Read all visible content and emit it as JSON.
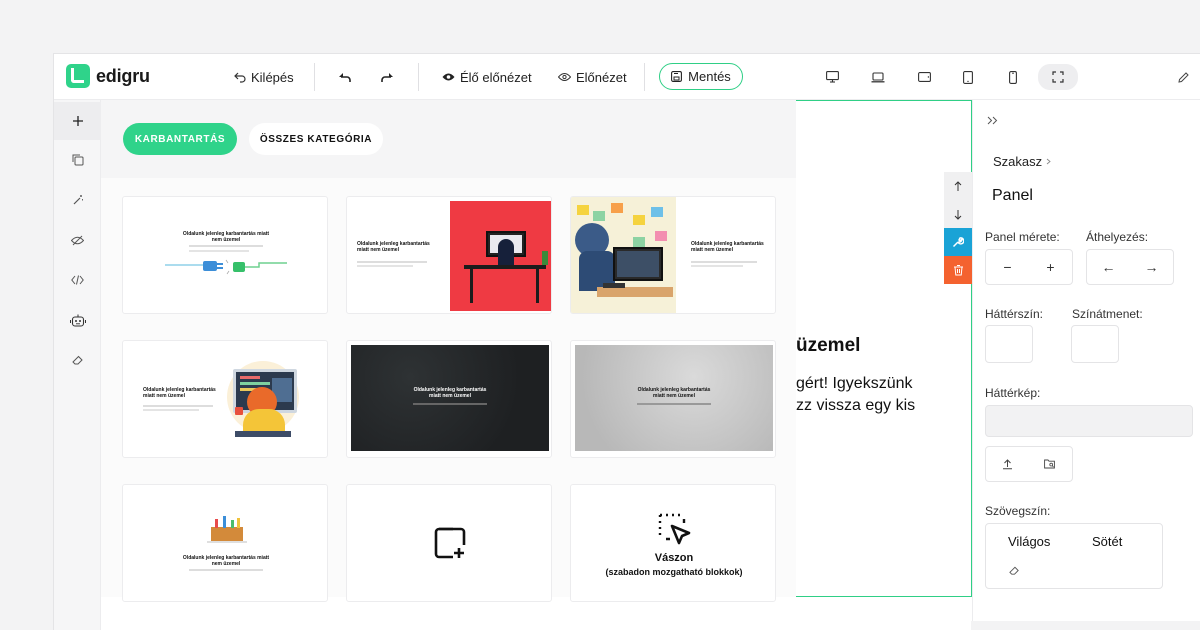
{
  "app": {
    "logo_text": "edigru"
  },
  "toolbar": {
    "exit_label": "Kilépés",
    "live_preview_label": "Élő előnézet",
    "preview_label": "Előnézet",
    "save_label": "Mentés"
  },
  "template_panel": {
    "tabs": [
      {
        "label": "KARBANTARTÁS",
        "active": true
      },
      {
        "label": "ÖSSZES KATEGÓRIA",
        "active": false
      }
    ],
    "card_title_small": "Oldalunk jelenleg karbantartás miatt nem üzemel",
    "canvas_card": {
      "title": "Vászon",
      "subtitle": "(szabadon mozgatható blokkok)"
    }
  },
  "canvas": {
    "heading_fragment": "üzemel",
    "text_line_1": "gért! Igyekszünk",
    "text_line_2": "zz vissza egy kis"
  },
  "settings": {
    "breadcrumb": "Szakasz",
    "panel_title": "Panel",
    "panel_size_label": "Panel mérete:",
    "move_label": "Áthelyezés:",
    "minus": "−",
    "plus": "+",
    "arrow_left": "←",
    "arrow_right": "→",
    "bg_color_label": "Háttérszín:",
    "gradient_label": "Színátmenet:",
    "bg_image_label": "Háttérkép:",
    "text_color_label": "Szövegszín:",
    "text_color_light": "Világos",
    "text_color_dark": "Sötét"
  },
  "colors": {
    "accent": "#2fd38a",
    "info": "#1aa3d6",
    "danger": "#f4622f"
  }
}
